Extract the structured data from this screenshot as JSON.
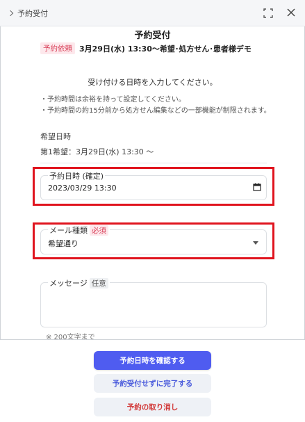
{
  "header": {
    "breadcrumb": "予約受付"
  },
  "content": {
    "title": "予約受付",
    "badge": "予約依頼",
    "summary": "3月29日(水) 13:30～希望･処方せん･患者様デモ",
    "instruction": "受け付ける日時を入力してください。",
    "notes": [
      "・予約時間は余裕を持って設定してください。",
      "・予約時間の約15分前から処方せん編集などの一部機能が制限されます。"
    ],
    "desired_label": "希望日時",
    "desired_value": "第1希望：3月29日(水) 13:30 ～"
  },
  "form": {
    "datetime": {
      "label": "予約日時 (確定)",
      "value": "2023/03/29  13:30"
    },
    "mail_type": {
      "label": "メール種類",
      "required": "必須",
      "value": "希望通り"
    },
    "message": {
      "label": "メッセージ",
      "optional": "任意",
      "value": ""
    },
    "hint": "※ 200文字まで"
  },
  "footer": {
    "confirm_label": "予約日時を確認する",
    "complete_without_label": "予約受付せずに完了する",
    "cancel_label": "予約の取り消し"
  },
  "colors": {
    "primary": "#4f5cf0",
    "danger_text": "#d23a3a",
    "highlight": "#e0141e",
    "badge_bg": "#fde8ec",
    "badge_text": "#d9435b"
  }
}
